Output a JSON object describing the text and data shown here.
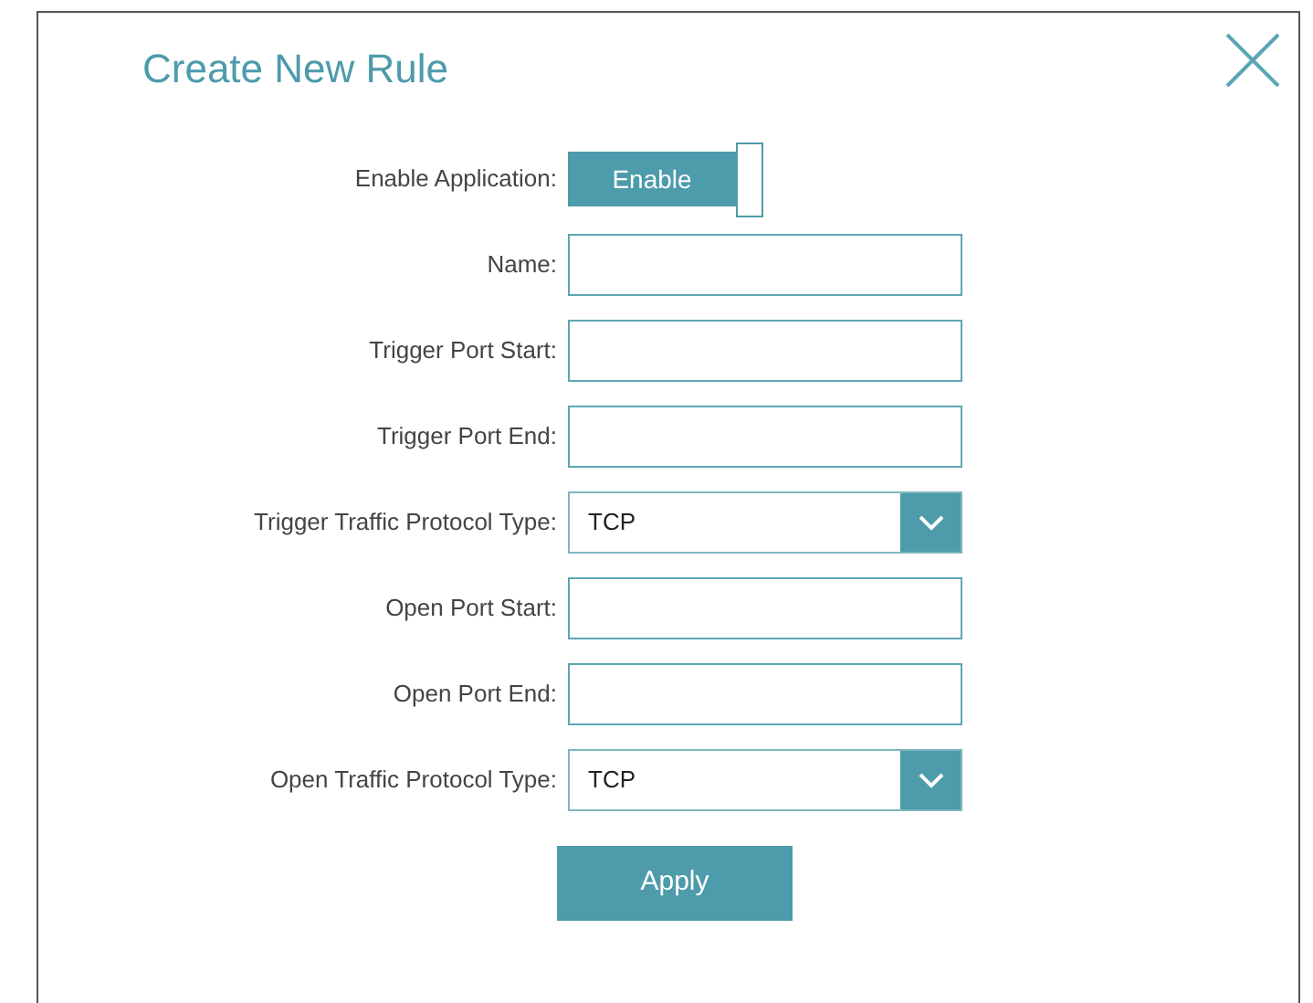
{
  "dialog": {
    "title": "Create New Rule"
  },
  "fields": [
    {
      "kind": "toggle",
      "label": "Enable Application:",
      "text": "Enable",
      "on": true
    },
    {
      "kind": "text",
      "label": "Name:"
    },
    {
      "kind": "text",
      "label": "Trigger Port Start:"
    },
    {
      "kind": "text",
      "label": "Trigger Port End:"
    },
    {
      "kind": "select",
      "label": "Trigger Traffic Protocol Type:",
      "value": "TCP"
    },
    {
      "kind": "text",
      "label": "Open Port Start:"
    },
    {
      "kind": "text",
      "label": "Open Port End:"
    },
    {
      "kind": "select",
      "label": "Open Traffic Protocol Type:",
      "value": "TCP"
    }
  ],
  "buttons": [
    "Apply"
  ]
}
